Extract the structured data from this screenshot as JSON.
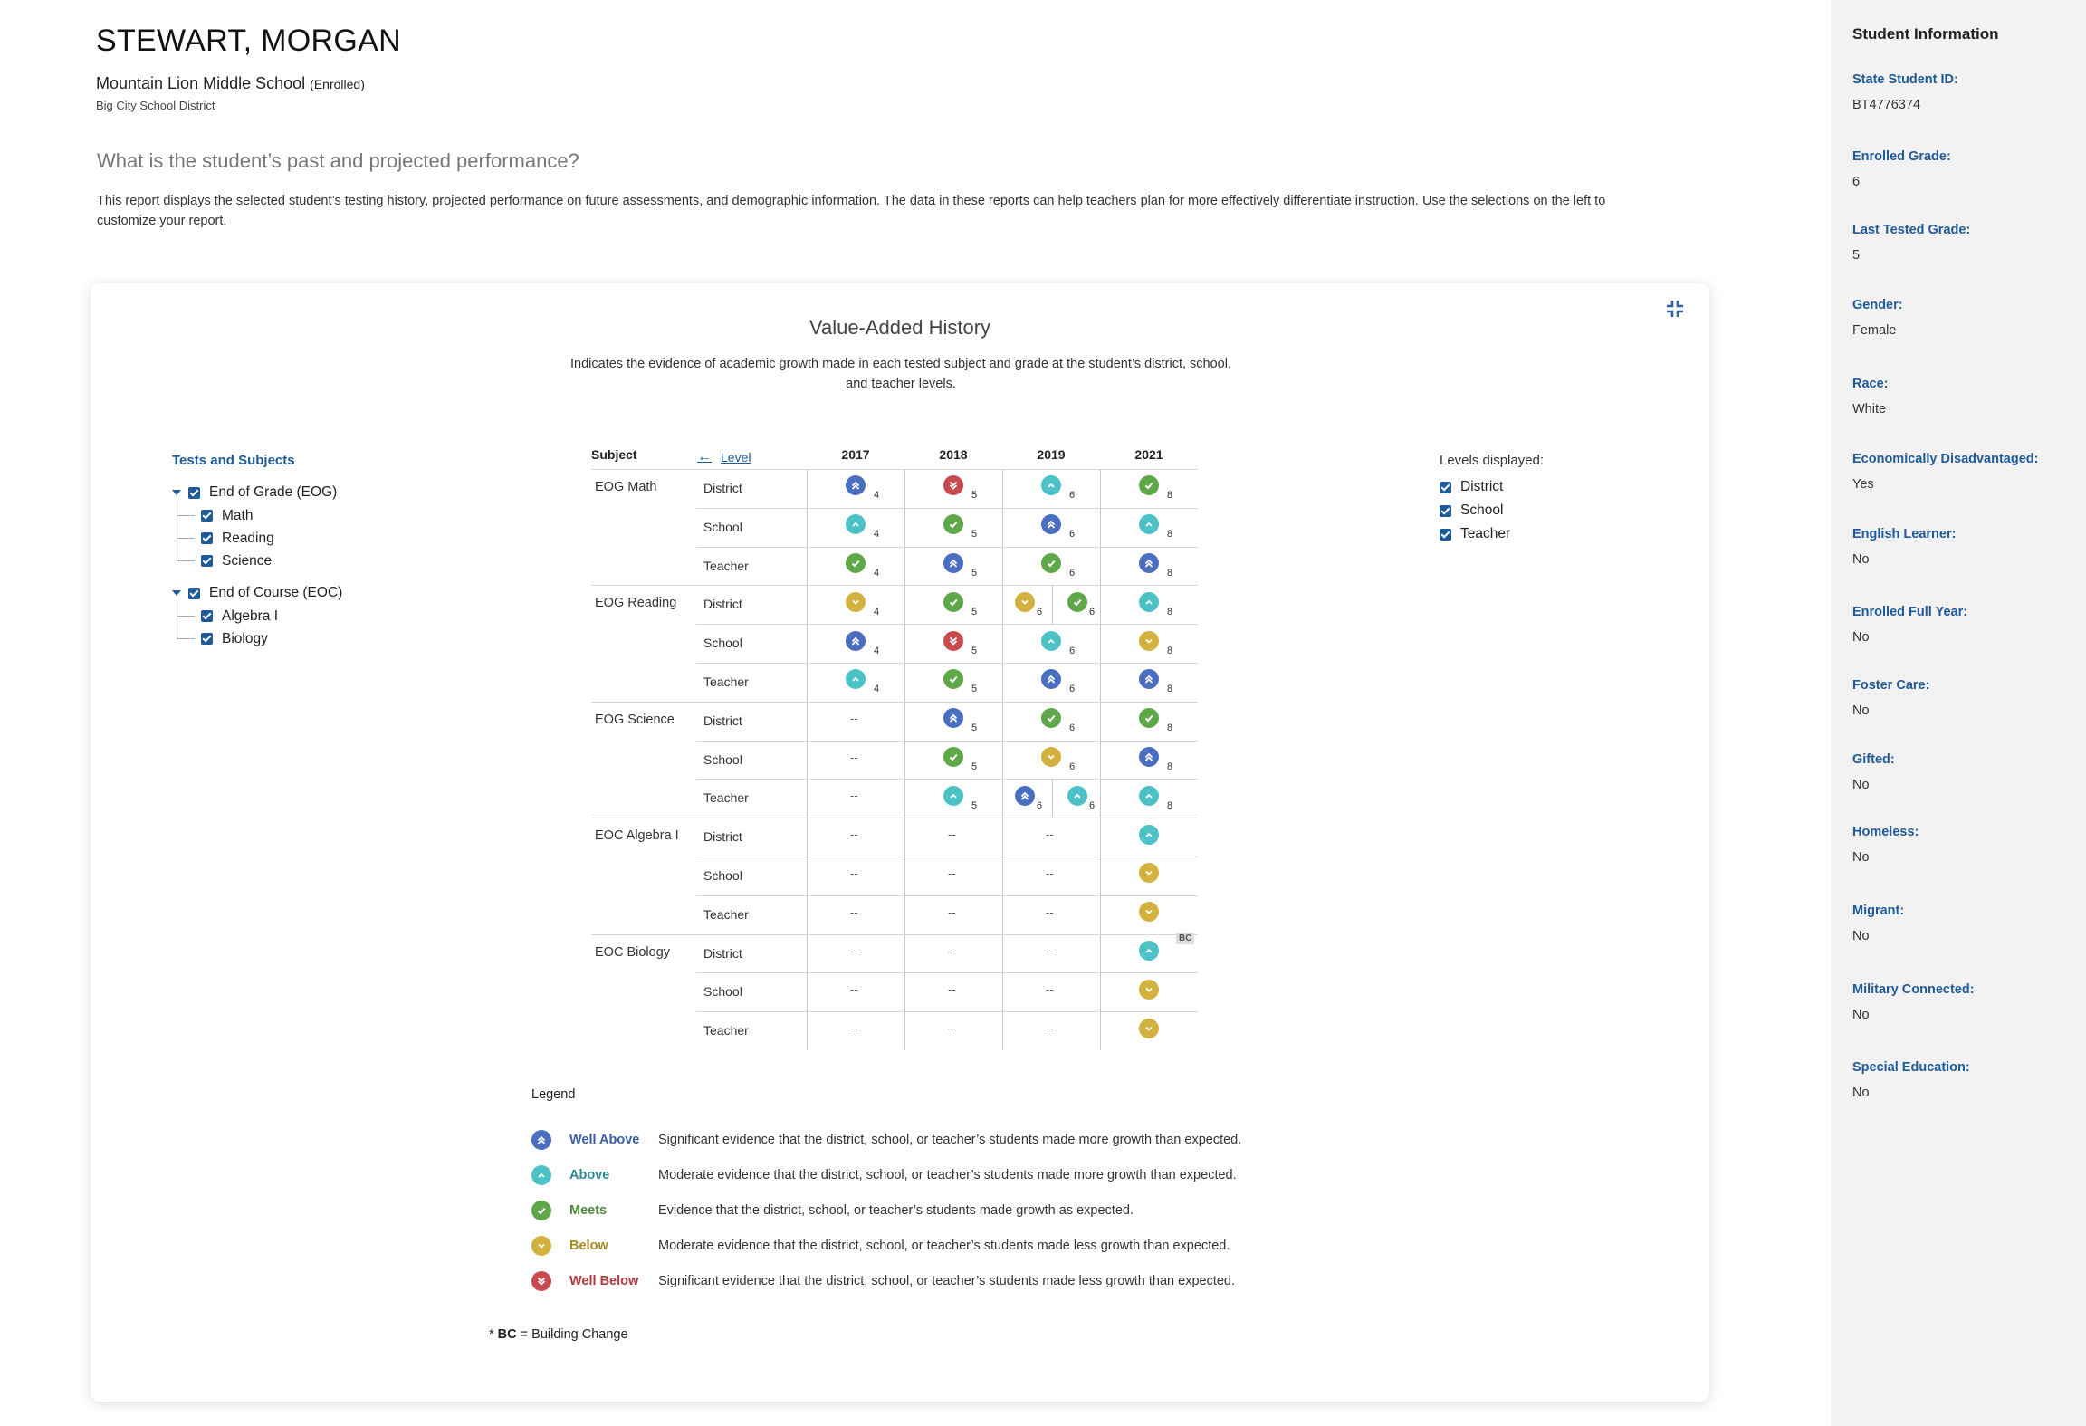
{
  "student": {
    "name": "STEWART, MORGAN",
    "school": "Mountain Lion Middle School",
    "enrollment_status": "(Enrolled)",
    "district": "Big City School District"
  },
  "page": {
    "question": "What is the student’s past and projected performance?",
    "description": "This report displays the selected student’s testing history,  projected performance on future assessments, and demographic information. The data in these reports can help teachers plan for more effectively differentiate  instruction. Use the selections on the left to customize your report."
  },
  "card": {
    "title": "Value-Added History",
    "subtitle": "Indicates the evidence of academic growth made in each tested subject and grade at the student’s district, school, and teacher levels.",
    "collapse_icon": "collapse-icon"
  },
  "tree": {
    "heading": "Tests and Subjects",
    "groups": [
      {
        "label": "End of Grade (EOG)",
        "children": [
          "Math",
          "Reading",
          "Science"
        ]
      },
      {
        "label": "End of Course (EOC)",
        "children": [
          "Algebra I",
          "Biology"
        ]
      }
    ]
  },
  "levels_panel": {
    "heading": "Levels displayed:",
    "items": [
      "District",
      "School",
      "Teacher"
    ]
  },
  "grid": {
    "headers": {
      "subject": "Subject",
      "level": "Level",
      "years": [
        "2017",
        "2018",
        "2019",
        "2021"
      ]
    },
    "rows": [
      {
        "subject": "EOG Math",
        "level": "District",
        "cells": [
          [
            {
              "r": "wa",
              "g": "4"
            }
          ],
          [
            {
              "r": "wb",
              "g": "5"
            }
          ],
          [
            {
              "r": "ab",
              "g": "6"
            }
          ],
          [
            {
              "r": "me",
              "g": "8"
            }
          ]
        ]
      },
      {
        "subject": "",
        "level": "School",
        "cells": [
          [
            {
              "r": "ab",
              "g": "4"
            }
          ],
          [
            {
              "r": "me",
              "g": "5"
            }
          ],
          [
            {
              "r": "wa",
              "g": "6"
            }
          ],
          [
            {
              "r": "ab",
              "g": "8"
            }
          ]
        ]
      },
      {
        "subject": "",
        "level": "Teacher",
        "cells": [
          [
            {
              "r": "me",
              "g": "4"
            }
          ],
          [
            {
              "r": "wa",
              "g": "5"
            }
          ],
          [
            {
              "r": "me",
              "g": "6"
            }
          ],
          [
            {
              "r": "wa",
              "g": "8"
            }
          ]
        ]
      },
      {
        "subject": "EOG Reading",
        "level": "District",
        "cells": [
          [
            {
              "r": "be",
              "g": "4"
            }
          ],
          [
            {
              "r": "me",
              "g": "5"
            }
          ],
          [
            {
              "r": "be",
              "g": "6"
            },
            {
              "r": "me",
              "g": "6"
            }
          ],
          [
            {
              "r": "ab",
              "g": "8"
            }
          ]
        ]
      },
      {
        "subject": "",
        "level": "School",
        "cells": [
          [
            {
              "r": "wa",
              "g": "4"
            }
          ],
          [
            {
              "r": "wb",
              "g": "5"
            }
          ],
          [
            {
              "r": "ab",
              "g": "6"
            }
          ],
          [
            {
              "r": "be",
              "g": "8"
            }
          ]
        ]
      },
      {
        "subject": "",
        "level": "Teacher",
        "cells": [
          [
            {
              "r": "ab",
              "g": "4"
            }
          ],
          [
            {
              "r": "me",
              "g": "5"
            }
          ],
          [
            {
              "r": "wa",
              "g": "6"
            }
          ],
          [
            {
              "r": "wa",
              "g": "8"
            }
          ]
        ]
      },
      {
        "subject": "EOG Science",
        "level": "District",
        "cells": [
          [],
          [
            {
              "r": "wa",
              "g": "5"
            }
          ],
          [
            {
              "r": "me",
              "g": "6"
            }
          ],
          [
            {
              "r": "me",
              "g": "8"
            }
          ]
        ]
      },
      {
        "subject": "",
        "level": "School",
        "cells": [
          [],
          [
            {
              "r": "me",
              "g": "5"
            }
          ],
          [
            {
              "r": "be",
              "g": "6"
            }
          ],
          [
            {
              "r": "wa",
              "g": "8"
            }
          ]
        ]
      },
      {
        "subject": "",
        "level": "Teacher",
        "cells": [
          [],
          [
            {
              "r": "ab",
              "g": "5"
            }
          ],
          [
            {
              "r": "wa",
              "g": "6"
            },
            {
              "r": "ab",
              "g": "6"
            }
          ],
          [
            {
              "r": "ab",
              "g": "8"
            }
          ]
        ]
      },
      {
        "subject": "EOC Algebra I",
        "level": "District",
        "cells": [
          [],
          [],
          [],
          [
            {
              "r": "ab",
              "g": ""
            }
          ]
        ]
      },
      {
        "subject": "",
        "level": "School",
        "cells": [
          [],
          [],
          [],
          [
            {
              "r": "be",
              "g": ""
            }
          ]
        ]
      },
      {
        "subject": "",
        "level": "Teacher",
        "cells": [
          [],
          [],
          [],
          [
            {
              "r": "be",
              "g": ""
            }
          ]
        ]
      },
      {
        "subject": "EOC Biology",
        "level": "District",
        "cells": [
          [],
          [],
          [],
          [
            {
              "r": "ab",
              "g": "",
              "bc": "BC"
            }
          ]
        ]
      },
      {
        "subject": "",
        "level": "School",
        "cells": [
          [],
          [],
          [],
          [
            {
              "r": "be",
              "g": ""
            }
          ]
        ]
      },
      {
        "subject": "",
        "level": "Teacher",
        "cells": [
          [],
          [],
          [],
          [
            {
              "r": "be",
              "g": ""
            }
          ]
        ]
      }
    ],
    "empty_mark": "--"
  },
  "legend": {
    "heading": "Legend",
    "items": [
      {
        "key": "wa",
        "icon": "double-chevron-up-icon",
        "label": "Well Above",
        "color": "#3a5ea8",
        "desc": "Significant evidence that the district, school, or teacher’s students made more growth than expected."
      },
      {
        "key": "ab",
        "icon": "chevron-up-icon",
        "label": "Above",
        "color": "#2e8a92",
        "desc": "Moderate evidence that the district, school, or teacher’s students made more growth than expected."
      },
      {
        "key": "me",
        "icon": "check-icon",
        "label": "Meets",
        "color": "#4a8a36",
        "desc": "Evidence that the district, school, or teacher’s students made growth as expected."
      },
      {
        "key": "be",
        "icon": "chevron-down-icon",
        "label": "Below",
        "color": "#a88a22",
        "desc": "Moderate evidence that the district, school, or teacher’s students made less growth than expected."
      },
      {
        "key": "wb",
        "icon": "double-chevron-down-icon",
        "label": "Well Below",
        "color": "#b03a40",
        "desc": "Significant evidence that the district, school, or teacher’s students made less growth than expected."
      }
    ],
    "bc_note_prefix": "* ",
    "bc_note_abbr": "BC",
    "bc_note_text": " = Building Change"
  },
  "sidebar": {
    "title": "Student Information",
    "fields": [
      {
        "label": "State Student ID:",
        "value": "BT4776374"
      },
      {
        "label": "Enrolled Grade:",
        "value": "6"
      },
      {
        "label": "Last Tested Grade:",
        "value": "5"
      },
      {
        "label": "Gender:",
        "value": "Female"
      },
      {
        "label": "Race:",
        "value": "White"
      },
      {
        "label": "Economically Disadvantaged:",
        "value": "Yes"
      },
      {
        "label": "English Learner:",
        "value": "No"
      },
      {
        "label": "Enrolled Full Year:",
        "value": "No"
      },
      {
        "label": "Foster Care:",
        "value": "No"
      },
      {
        "label": "Gifted:",
        "value": "No"
      },
      {
        "label": "Homeless:",
        "value": "No"
      },
      {
        "label": "Migrant:",
        "value": "No"
      },
      {
        "label": "Military Connected:",
        "value": "No"
      },
      {
        "label": "Special Education:",
        "value": "No"
      }
    ]
  },
  "colors": {
    "accent": "#1f5a99",
    "well_above": "#4a6fc1",
    "above": "#4cc1c6",
    "meets": "#5fa849",
    "below": "#d3b13f",
    "well_below": "#c84a4f"
  }
}
